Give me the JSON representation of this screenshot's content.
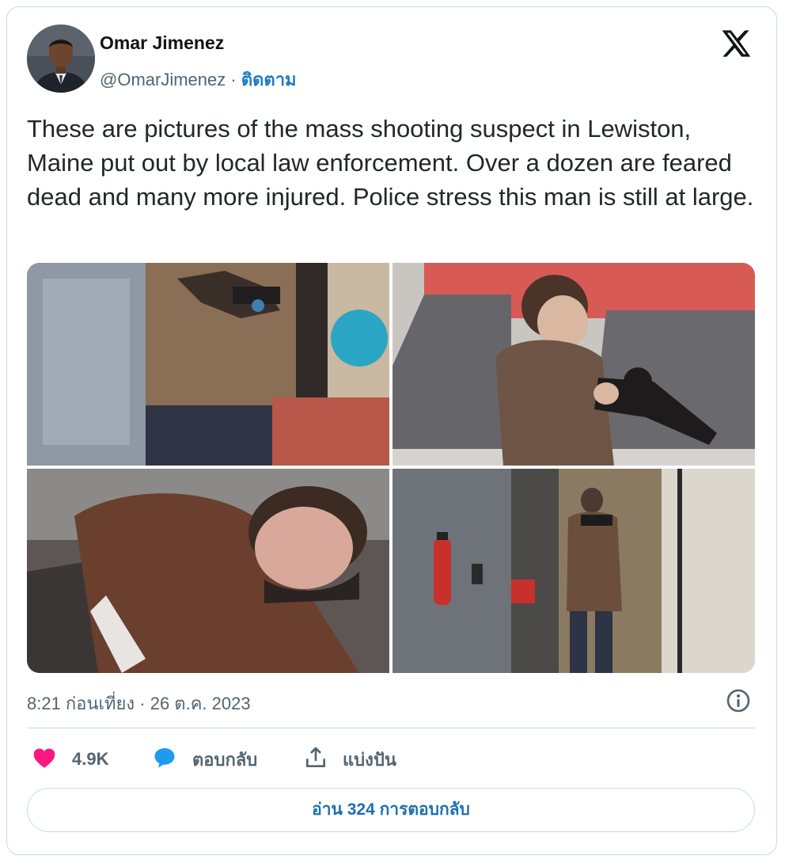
{
  "author": {
    "name": "Omar Jimenez",
    "handle": "@OmarJimenez",
    "separator": " · ",
    "follow_label": "ติดตาม"
  },
  "platform_logo": "x-logo",
  "tweet": {
    "text": "These are pictures of the mass shooting suspect in Lewiston, Maine put out by local law enforcement. Over a dozen are feared dead and many more injured. Police stress this man is still at large."
  },
  "media": {
    "photos": [
      {
        "description_icon": "photo"
      },
      {
        "description_icon": "photo"
      },
      {
        "description_icon": "photo"
      },
      {
        "description_icon": "photo"
      }
    ]
  },
  "timestamp": "8:21 ก่อนเที่ยง · 26 ต.ค. 2023",
  "actions": {
    "like_count": "4.9K",
    "reply_label": "ตอบกลับ",
    "share_label": "แบ่งปัน"
  },
  "read_replies_label": "อ่าน 324 การตอบกลับ",
  "colors": {
    "like": "#f91880",
    "reply": "#1d9bf0",
    "link": "#1d6fb0"
  }
}
